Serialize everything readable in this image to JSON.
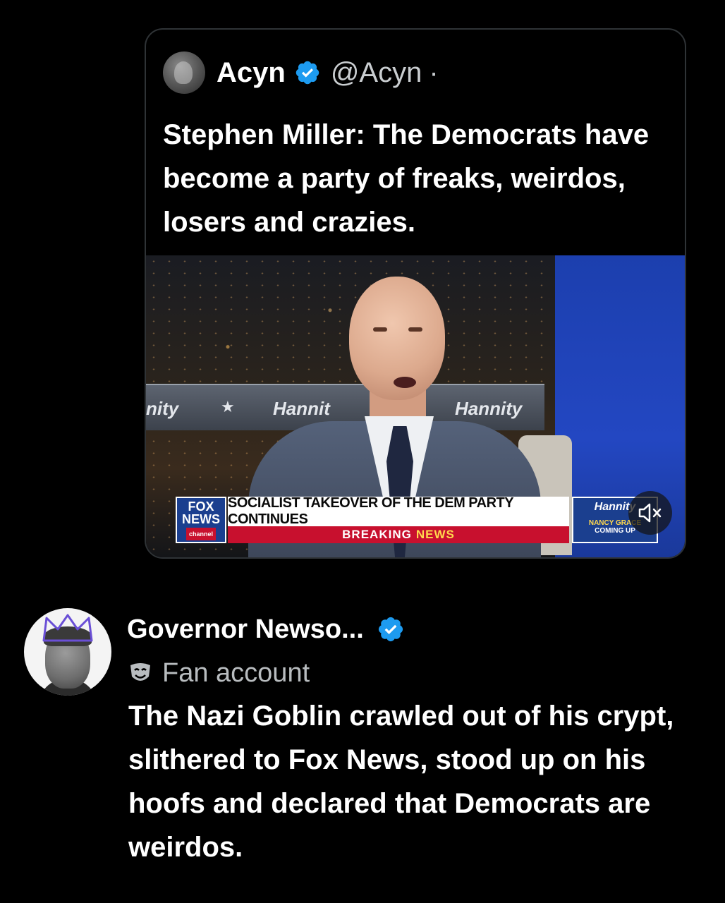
{
  "quoted_tweet": {
    "author_name": "Acyn",
    "handle": "@Acyn",
    "separator": "·",
    "text": "Stephen Miller: The Democrats have become a party of freaks, weirdos, losers and crazies.",
    "media": {
      "chyron_headline": "SOCIALIST TAKEOVER OF THE DEM PARTY CONTINUES",
      "chyron_breaking": "BREAKING",
      "chyron_news": "NEWS",
      "network_logo_line1": "FOX",
      "network_logo_line2": "NEWS",
      "network_logo_line3": "channel",
      "backdrop_left": "nity",
      "backdrop_mid": "Hannit",
      "backdrop_right": "Hannity",
      "side_show": "Hannity",
      "side_next_name": "NANCY GRACE",
      "side_next_label": "COMING UP",
      "mute_icon": "speaker-muted-icon"
    }
  },
  "reply_tweet": {
    "author_name": "Governor Newso...",
    "label": "Fan account",
    "label_icon": "mask-icon",
    "text": "The Nazi Goblin crawled out of his crypt, slithered to Fox News, stood up on his hoofs and declared that Democrats are weirdos."
  },
  "colors": {
    "background": "#000000",
    "verified_blue": "#1d9bf0",
    "text_primary": "#ffffff",
    "text_secondary": "#b8bcbf",
    "fox_red": "#c8102e",
    "fox_blue": "#1b3f8f"
  }
}
